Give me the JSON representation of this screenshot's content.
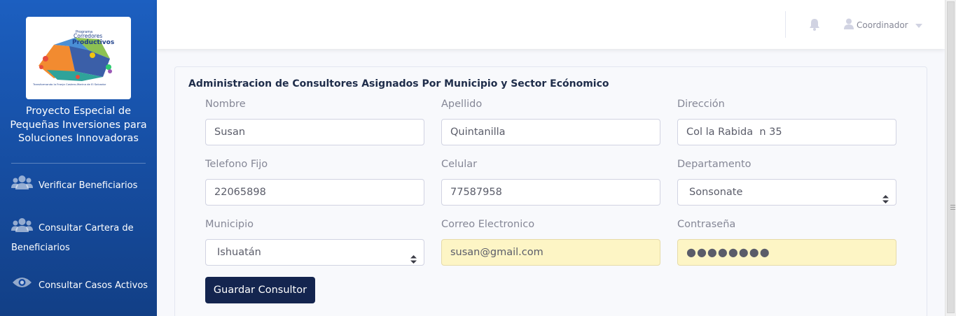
{
  "sidebar": {
    "logo": {
      "program": "Programa",
      "title_line1": "Corredores",
      "title_line2": "Productivos",
      "tagline": "Transformando la Franja Costero-Marina de El Salvador"
    },
    "brand_lines": [
      "Proyecto Especial de",
      "Pequeñas Inversiones para",
      "Soluciones Innovadoras"
    ],
    "nav": [
      {
        "label": "Verificar Beneficiarios",
        "icon": "users-icon"
      },
      {
        "label_line1": "Consultar Cartera de",
        "label_line2": "Beneficiarios",
        "icon": "users-icon"
      },
      {
        "label": "Consultar Casos Activos",
        "icon": "eye-icon"
      }
    ]
  },
  "topbar": {
    "user_label": "Coordinador",
    "icons": [
      "bell-icon",
      "user-icon",
      "caret-down-icon"
    ]
  },
  "form": {
    "title": "Administracion de Consultores Asignados Por Municipio y Sector Ecónomico",
    "fields": {
      "nombre": {
        "label": "Nombre",
        "value": "Susan"
      },
      "apellido": {
        "label": "Apellido",
        "value": "Quintanilla"
      },
      "direccion": {
        "label": "Dirección",
        "value": "Col la Rabida  n 35"
      },
      "telefono": {
        "label": "Telefono Fijo",
        "value": "22065898"
      },
      "celular": {
        "label": "Celular",
        "value": "77587958"
      },
      "departamento": {
        "label": "Departamento",
        "value": "Sonsonate"
      },
      "municipio": {
        "label": "Municipio",
        "value": "Ishuatán"
      },
      "correo": {
        "label": "Correo Electronico",
        "value": "susan@gmail.com"
      },
      "contrasena": {
        "label": "Contraseña",
        "value": "●●●●●●●●"
      }
    },
    "submit_label": "Guardar Consultor"
  },
  "colors": {
    "sidebar_top": "#1c5fc0",
    "sidebar_bottom": "#123f86",
    "button": "#14254f",
    "autofill": "#fdf5c5"
  }
}
